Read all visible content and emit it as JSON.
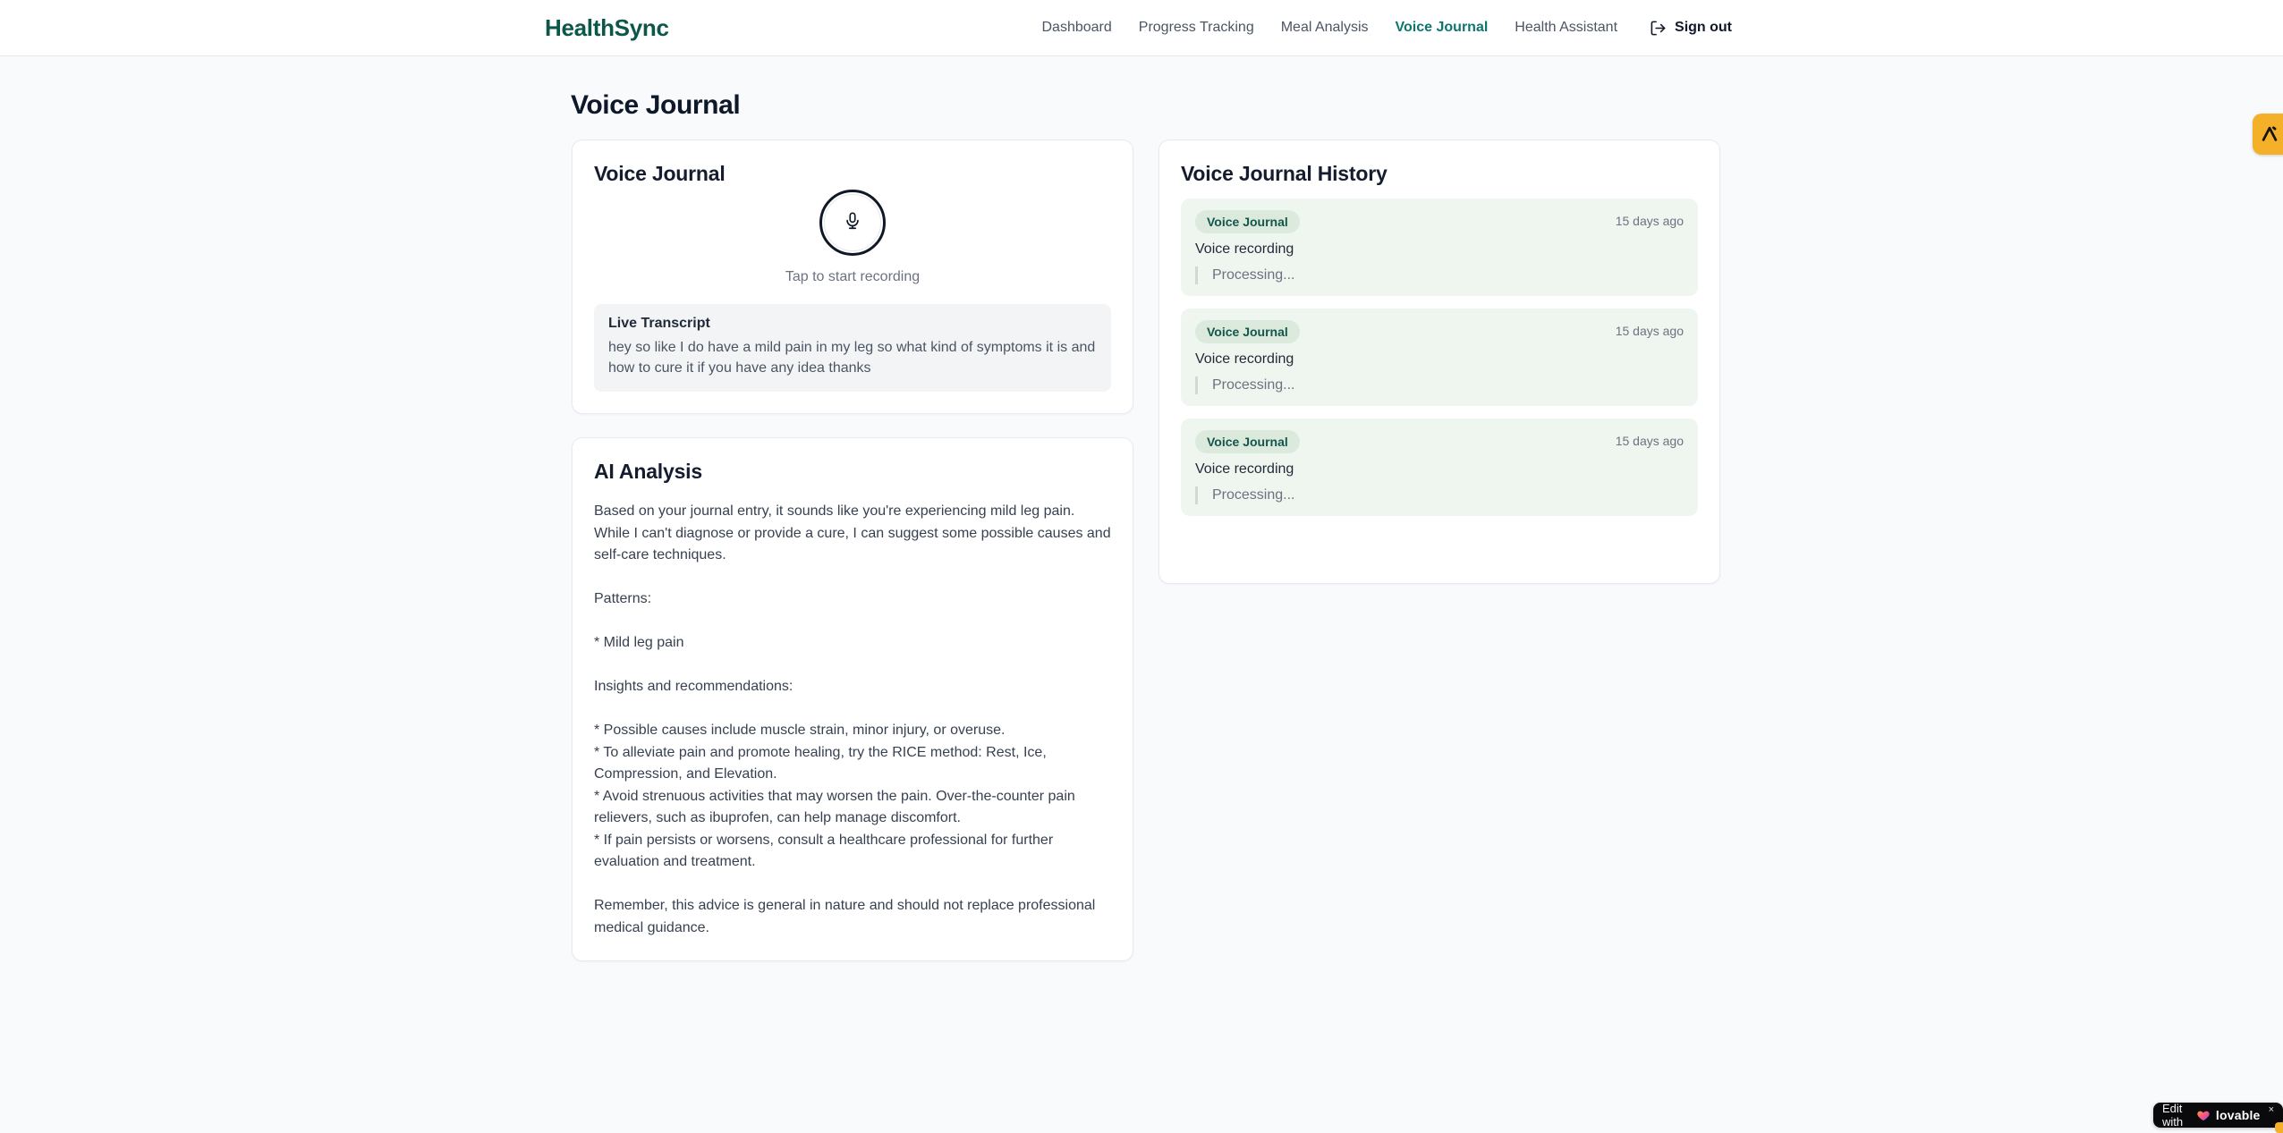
{
  "brand": {
    "name": "HealthSync"
  },
  "nav": {
    "items": [
      {
        "label": "Dashboard"
      },
      {
        "label": "Progress Tracking"
      },
      {
        "label": "Meal Analysis"
      },
      {
        "label": "Voice Journal"
      },
      {
        "label": "Health Assistant"
      }
    ],
    "sign_out_label": "Sign out"
  },
  "page": {
    "title": "Voice Journal"
  },
  "recorder": {
    "card_title": "Voice Journal",
    "tap_hint": "Tap to start recording",
    "transcript_label": "Live Transcript",
    "transcript_text": "hey so like I do have a mild pain in my leg so what kind of symptoms it is and how to cure it if you have any idea thanks"
  },
  "analysis": {
    "card_title": "AI Analysis",
    "body": "Based on your journal entry, it sounds like you're experiencing mild leg pain. While I can't diagnose or provide a cure, I can suggest some possible causes and self-care techniques.\n\nPatterns:\n\n* Mild leg pain\n\nInsights and recommendations:\n\n* Possible causes include muscle strain, minor injury, or overuse.\n* To alleviate pain and promote healing, try the RICE method: Rest, Ice, Compression, and Elevation.\n* Avoid strenuous activities that may worsen the pain. Over-the-counter pain relievers, such as ibuprofen, can help manage discomfort.\n* If pain persists or worsens, consult a healthcare professional for further evaluation and treatment.\n\nRemember, this advice is general in nature and should not replace professional medical guidance."
  },
  "history": {
    "card_title": "Voice Journal History",
    "entries": [
      {
        "badge": "Voice Journal",
        "time": "15 days ago",
        "title": "Voice recording",
        "status": "Processing..."
      },
      {
        "badge": "Voice Journal",
        "time": "15 days ago",
        "title": "Voice recording",
        "status": "Processing..."
      },
      {
        "badge": "Voice Journal",
        "time": "15 days ago",
        "title": "Voice recording",
        "status": "Processing..."
      }
    ]
  },
  "overlays": {
    "edit_badge": {
      "prefix": "Edit with",
      "brand": "lovable",
      "close": "×"
    }
  },
  "colors": {
    "brand_green": "#0c574a",
    "active_nav_teal": "#0f766e",
    "history_entry_bg": "#eff6ef",
    "badge_bg": "#dce9dd",
    "badge_text": "#14564c",
    "accent_amber": "#f5b02a"
  }
}
